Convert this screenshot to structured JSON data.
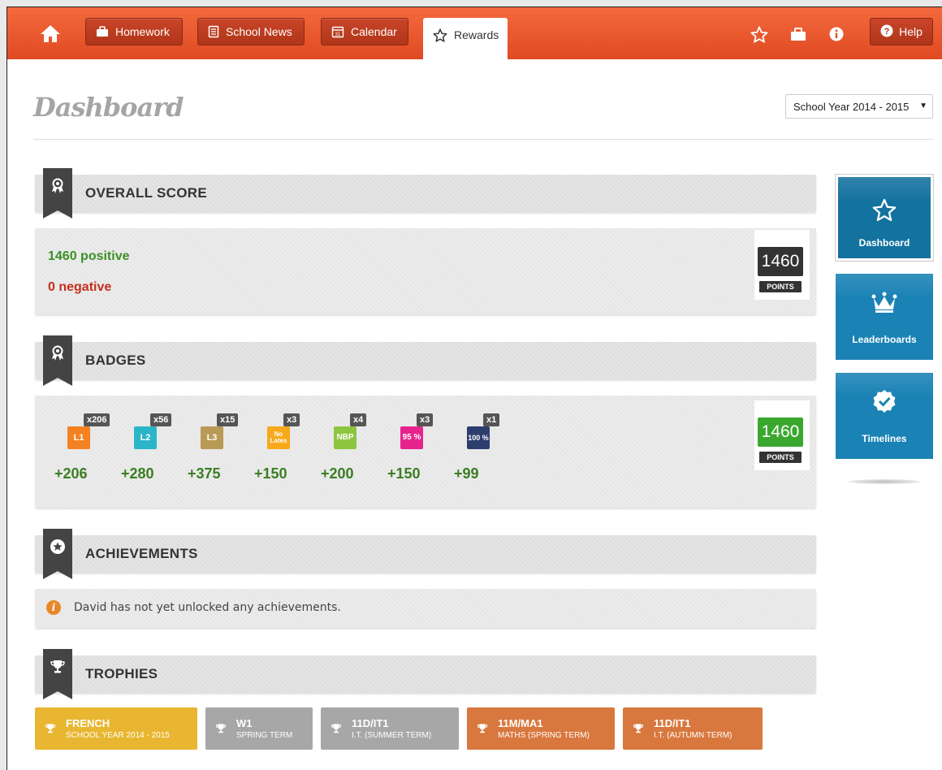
{
  "nav": {
    "homework": "Homework",
    "school_news": "School News",
    "calendar": "Calendar",
    "rewards": "Rewards",
    "help": "Help"
  },
  "page": {
    "title": "Dashboard",
    "year_select": "School Year 2014 - 2015"
  },
  "overall": {
    "title": "OVERALL SCORE",
    "positive": "1460 positive",
    "negative": "0 negative",
    "points": "1460",
    "points_label": "POINTS"
  },
  "badges": {
    "title": "BADGES",
    "points": "1460",
    "points_label": "POINTS",
    "items": [
      {
        "icon": "L1",
        "count": "x206",
        "value": "+206",
        "color": "#f58220"
      },
      {
        "icon": "L2",
        "count": "x56",
        "value": "+280",
        "color": "#2bb5c8"
      },
      {
        "icon": "L3",
        "count": "x15",
        "value": "+375",
        "color": "#b89a55"
      },
      {
        "icon": "No Lates",
        "count": "x3",
        "value": "+150",
        "color": "#f7a81b"
      },
      {
        "icon": "NBP",
        "count": "x4",
        "value": "+200",
        "color": "#8cc63f"
      },
      {
        "icon": "95 %",
        "count": "x3",
        "value": "+150",
        "color": "#e6238c"
      },
      {
        "icon": "100 %",
        "count": "x1",
        "value": "+99",
        "color": "#2d3e6e"
      }
    ]
  },
  "achievements": {
    "title": "ACHIEVEMENTS",
    "message": "David has not yet unlocked any achievements."
  },
  "trophies": {
    "title": "TROPHIES",
    "items": [
      {
        "name": "FRENCH",
        "sub": "SCHOOL YEAR 2014 - 2015",
        "color": "#e8b630"
      },
      {
        "name": "W1",
        "sub": "SPRING TERM",
        "color": "#a7a7a7"
      },
      {
        "name": "11D/IT1",
        "sub": "I.T. (SUMMER TERM)",
        "color": "#a7a7a7"
      },
      {
        "name": "11M/MA1",
        "sub": "MATHS (SPRING TERM)",
        "color": "#d8783e"
      },
      {
        "name": "11D/IT1",
        "sub": "I.T. (AUTUMN TERM)",
        "color": "#d8783e"
      }
    ]
  },
  "side": {
    "dashboard": "Dashboard",
    "leaderboards": "Leaderboards",
    "timelines": "Timelines"
  },
  "colors": {
    "nav": "#e9552c",
    "positive": "#3b8f24",
    "negative": "#c62e1c",
    "badge_points": "#3aa82f",
    "tile": "#1a82b5"
  }
}
